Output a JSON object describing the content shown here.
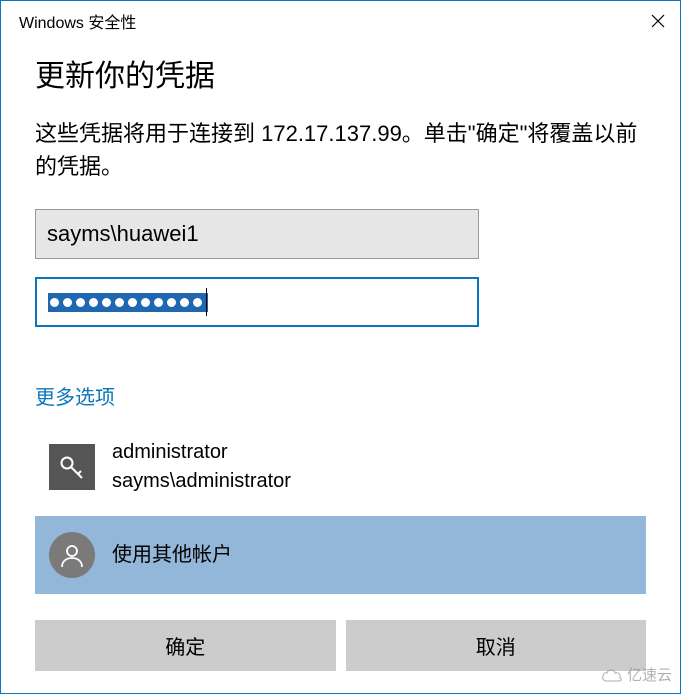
{
  "titlebar": {
    "title": "Windows 安全性"
  },
  "heading": "更新你的凭据",
  "description": "这些凭据将用于连接到 172.17.137.99。单击\"确定\"将覆盖以前的凭据。",
  "username": {
    "value": "sayms\\huawei1"
  },
  "password": {
    "dot_count": 12
  },
  "more_options": "更多选项",
  "accounts": {
    "admin": {
      "line1": "administrator",
      "line2": "sayms\\administrator"
    },
    "other": {
      "label": "使用其他帐户"
    }
  },
  "buttons": {
    "ok": "确定",
    "cancel": "取消"
  },
  "watermark": "亿速云"
}
